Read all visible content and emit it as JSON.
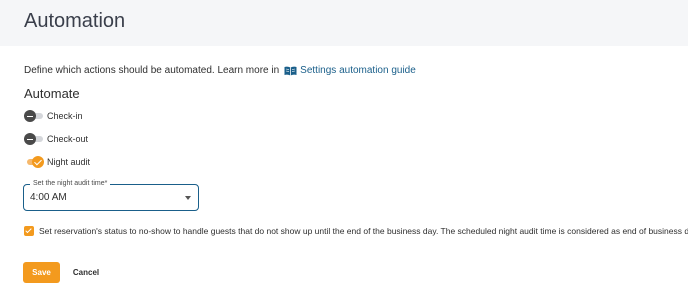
{
  "header": {
    "title": "Automation"
  },
  "intro": {
    "text": "Define which actions should be automated. Learn more in",
    "link_label": "Settings automation guide",
    "link_icon": "book-icon"
  },
  "automate": {
    "title": "Automate",
    "toggles": [
      {
        "label": "Check-in",
        "enabled": false
      },
      {
        "label": "Check-out",
        "enabled": false
      },
      {
        "label": "Night audit",
        "enabled": true
      }
    ]
  },
  "night_audit_time": {
    "label": "Set the night audit time*",
    "value": "4:00 AM"
  },
  "no_show": {
    "checked": true,
    "label": "Set reservation's status to no-show to handle guests that do not show up until the end of the business day. The scheduled night audit time is considered as end of business day."
  },
  "actions": {
    "save_label": "Save",
    "cancel_label": "Cancel"
  },
  "colors": {
    "accent": "#f39a1e",
    "link": "#1a5f8a",
    "header_bg": "#f5f6f8"
  }
}
